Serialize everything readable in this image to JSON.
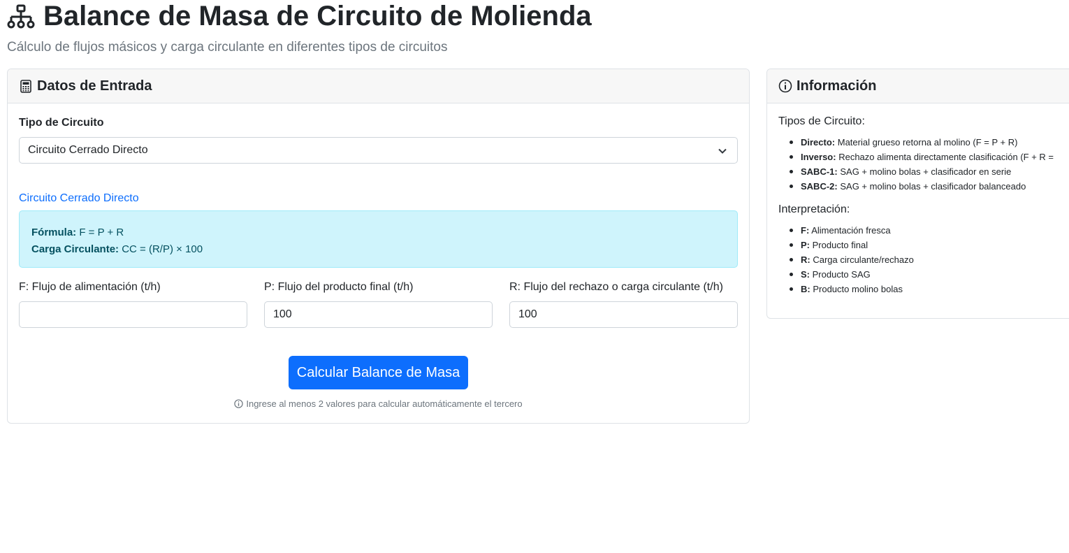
{
  "header": {
    "title": "Balance de Masa de Circuito de Molienda",
    "subtitle": "Cálculo de flujos másicos y carga circulante en diferentes tipos de circuitos"
  },
  "input_card": {
    "title": "Datos de Entrada",
    "circuit_type_label": "Tipo de Circuito",
    "circuit_type_selected": "Circuito Cerrado Directo",
    "circuit_title": "Circuito Cerrado Directo",
    "formula_label": "Fórmula:",
    "formula_value": "F = P + R",
    "circulating_label": "Carga Circulante:",
    "circulating_value": "CC = (R/P) × 100",
    "fields": {
      "f_label": "F: Flujo de alimentación (t/h)",
      "f_value": "",
      "p_label": "P: Flujo del producto final (t/h)",
      "p_value": "100",
      "r_label": "R: Flujo del rechazo o carga circulante (t/h)",
      "r_value": "100"
    },
    "calculate_button": "Calcular Balance de Masa",
    "hint": "Ingrese al menos 2 valores para calcular automáticamente el tercero"
  },
  "info_card": {
    "title": "Información",
    "circuit_types_heading": "Tipos de Circuito:",
    "circuit_types": [
      {
        "key": "Directo:",
        "text": "Material grueso retorna al molino (F = P + R)"
      },
      {
        "key": "Inverso:",
        "text": "Rechazo alimenta directamente clasificación (F + R ="
      },
      {
        "key": "SABC-1:",
        "text": "SAG + molino bolas + clasificador en serie"
      },
      {
        "key": "SABC-2:",
        "text": "SAG + molino bolas + clasificador balanceado"
      }
    ],
    "interpretation_heading": "Interpretación:",
    "interpretation": [
      {
        "key": "F:",
        "text": "Alimentación fresca"
      },
      {
        "key": "P:",
        "text": "Producto final"
      },
      {
        "key": "R:",
        "text": "Carga circulante/rechazo"
      },
      {
        "key": "S:",
        "text": "Producto SAG"
      },
      {
        "key": "B:",
        "text": "Producto molino bolas"
      }
    ]
  },
  "colors": {
    "primary": "#0d6efd",
    "info_bg": "#cff4fc",
    "info_text": "#055160",
    "muted": "#6c757d"
  },
  "icons": {
    "title": "diagram-3-icon",
    "input_card": "calculator-icon",
    "info_card": "info-circle-icon",
    "select": "chevron-down-icon",
    "hint": "info-circle-icon"
  }
}
